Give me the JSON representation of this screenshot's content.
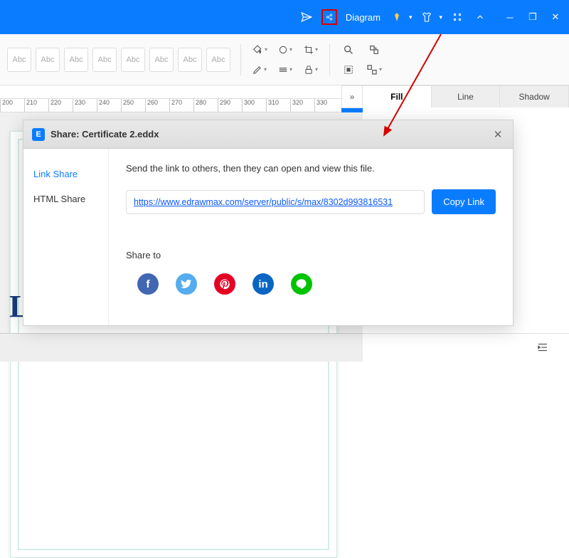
{
  "titlebar": {
    "diagram_label": "Diagram"
  },
  "side_tabs": {
    "fill": "Fill",
    "line": "Line",
    "shadow": "Shadow"
  },
  "ruler": [
    "200",
    "210",
    "220",
    "230",
    "240",
    "250",
    "260",
    "270",
    "280",
    "290",
    "300",
    "310",
    "320",
    "330"
  ],
  "style_buttons": [
    "Abc",
    "Abc",
    "Abc",
    "Abc",
    "Abc",
    "Abc",
    "Abc",
    "Abc"
  ],
  "canvas": {
    "visible_letters": "L"
  },
  "dialog": {
    "title": "Share: Certificate 2.eddx",
    "nav": {
      "link": "Link Share",
      "html": "HTML Share"
    },
    "instruction": "Send the link to others, then they can open and view this file.",
    "url": "https://www.edrawmax.com/server/public/s/max/8302d993816531",
    "copy": "Copy Link",
    "share_to": "Share to"
  }
}
